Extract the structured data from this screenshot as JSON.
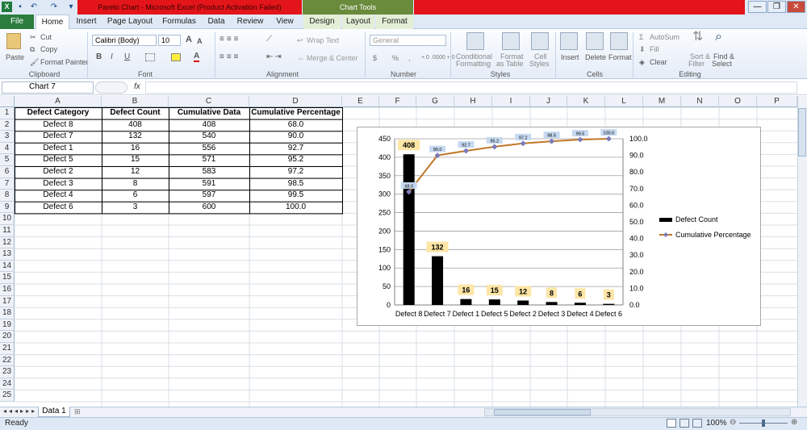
{
  "window": {
    "title": "Pareto Chart  -  Microsoft Excel (Product Activation Failed)",
    "contextual_title": "Chart Tools",
    "excel_icon": "excel-logo",
    "quick_access": {
      "save_icon": "save-icon",
      "undo_icon": "undo-icon",
      "redo_icon": "redo-icon",
      "customize_icon": "customize-icon"
    },
    "controls": {
      "minimize": "—",
      "restore": "❐",
      "close": "✕"
    }
  },
  "tabs": [
    "File",
    "Home",
    "Insert",
    "Page Layout",
    "Formulas",
    "Data",
    "Review",
    "View",
    "Design",
    "Layout",
    "Format"
  ],
  "ribbon": {
    "clipboard": {
      "paste": "Paste",
      "cut": "Cut",
      "copy": "Copy",
      "format_painter": "Format Painter",
      "group": "Clipboard"
    },
    "font": {
      "name": "Calibri (Body)",
      "size": "10",
      "bold": "B",
      "italic": "I",
      "underline": "U",
      "grow": "A",
      "shrink": "A",
      "font_color": "A",
      "group": "Font"
    },
    "alignment": {
      "wrap_text": "Wrap Text",
      "merge_center": "Merge & Center",
      "group": "Alignment"
    },
    "number": {
      "format": "General",
      "currency": "$",
      "percent": "%",
      "comma": ",",
      "inc_decimal": "+.0 .00",
      "dec_decimal": ".00 +.0",
      "group": "Number"
    },
    "styles": {
      "conditional": [
        "Conditional",
        "Formatting"
      ],
      "format_table": [
        "Format",
        "as Table"
      ],
      "cell_styles": [
        "Cell",
        "Styles"
      ],
      "group": "Styles"
    },
    "cells": {
      "insert": "Insert",
      "delete": "Delete",
      "format": "Format",
      "group": "Cells"
    },
    "editing": {
      "autosum": "AutoSum",
      "fill": "Fill",
      "clear": "Clear",
      "sort_filter": [
        "Sort &",
        "Filter"
      ],
      "find_select": [
        "Find &",
        "Select"
      ],
      "group": "Editing"
    }
  },
  "formula_bar": {
    "name_box": "Chart 7",
    "fx": "fx",
    "formula": ""
  },
  "columns": [
    "A",
    "B",
    "C",
    "D",
    "E",
    "F",
    "G",
    "H",
    "I",
    "J",
    "K",
    "L",
    "M",
    "N",
    "O",
    "P"
  ],
  "rows": [
    "1",
    "2",
    "3",
    "4",
    "5",
    "6",
    "7",
    "8",
    "9",
    "10",
    "11",
    "12",
    "13",
    "14",
    "15",
    "16",
    "17",
    "18",
    "19",
    "20",
    "21",
    "22",
    "23",
    "24",
    "25"
  ],
  "table": {
    "headers": [
      "Defect Category",
      "Defect Count",
      "Cumulative Data",
      "Cumulative Percentage"
    ],
    "rows": [
      [
        "Defect 8",
        "408",
        "408",
        "68.0"
      ],
      [
        "Defect 7",
        "132",
        "540",
        "90.0"
      ],
      [
        "Defect 1",
        "16",
        "556",
        "92.7"
      ],
      [
        "Defect 5",
        "15",
        "571",
        "95.2"
      ],
      [
        "Defect 2",
        "12",
        "583",
        "97.2"
      ],
      [
        "Defect 3",
        "8",
        "591",
        "98.5"
      ],
      [
        "Defect 4",
        "6",
        "597",
        "99.5"
      ],
      [
        "Defect 6",
        "3",
        "600",
        "100.0"
      ]
    ]
  },
  "chart_data": {
    "type": "bar",
    "categories": [
      "Defect 8",
      "Defect 7",
      "Defect 1",
      "Defect 5",
      "Defect 2",
      "Defect 3",
      "Defect 4",
      "Defect 6"
    ],
    "series": [
      {
        "name": "Defect Count",
        "type": "bar",
        "axis": "left",
        "values": [
          408,
          132,
          16,
          15,
          12,
          8,
          6,
          3
        ],
        "labels": [
          "408",
          "132",
          "16",
          "15",
          "12",
          "8",
          "6",
          "3"
        ]
      },
      {
        "name": "Cumulative Percentage",
        "type": "line",
        "axis": "right",
        "values": [
          68.0,
          90.0,
          92.7,
          95.2,
          97.2,
          98.5,
          99.5,
          100.0
        ],
        "labels": [
          "68.0",
          "90.0",
          "92.7",
          "95.2",
          "97.2",
          "98.5",
          "99.5",
          "100.0"
        ]
      }
    ],
    "ylim": [
      0,
      450
    ],
    "y_ticks": [
      "0",
      "50",
      "100",
      "150",
      "200",
      "250",
      "300",
      "350",
      "400",
      "450"
    ],
    "y2lim": [
      0,
      100
    ],
    "y2_ticks": [
      "0.0",
      "10.0",
      "20.0",
      "30.0",
      "40.0",
      "50.0",
      "60.0",
      "70.0",
      "80.0",
      "90.0",
      "100.0"
    ],
    "legend": "right",
    "grid": true,
    "colors": {
      "bar": "#000000",
      "line": "#c0782a",
      "marker": "#7a7ab8",
      "bar_label_bg": "#fde5a5",
      "line_label_bg": "#c6d9f1"
    }
  },
  "sheets": {
    "active": "Data 1"
  },
  "status": {
    "ready": "Ready",
    "zoom": "100%"
  }
}
